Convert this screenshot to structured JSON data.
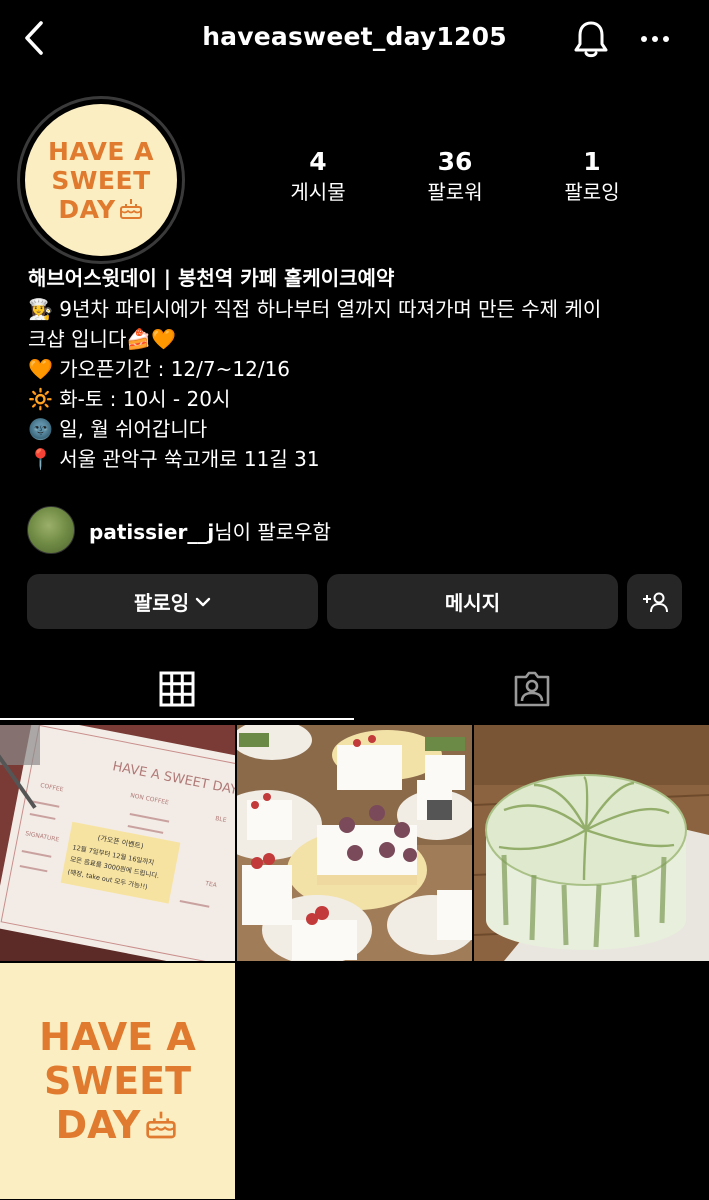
{
  "header": {
    "username": "haveasweet_day1205",
    "back_icon": "chevron-left-icon",
    "bell_icon": "bell-icon",
    "more_icon": "more-horizontal-icon"
  },
  "profile": {
    "avatar_text": [
      "HAVE A",
      "SWEET",
      "DAY"
    ],
    "stats": [
      {
        "value": "4",
        "label": "게시물"
      },
      {
        "value": "36",
        "label": "팔로워"
      },
      {
        "value": "1",
        "label": "팔로잉"
      }
    ],
    "name": "해브어스윗데이 | 봉천역 카페 홀케이크예약",
    "bio_lines": [
      "👩‍🍳 9년차 파티시에가 직접 하나부터 열까지 따져가며 만든 수제 케이",
      "크샵 입니다🍰🧡",
      "🧡 가오픈기간 : 12/7~12/16",
      "🔆 화-토 : 10시 - 20시",
      "🌚 일, 월 쉬어갑니다",
      "📍 서울 관악구 쑥고개로 11길 31"
    ],
    "followed_by_user": "patissier__j",
    "followed_by_suffix": "님이 팔로우함"
  },
  "actions": {
    "following_label": "팔로잉",
    "message_label": "메시지",
    "add_person_icon": "add-person-icon"
  },
  "tabs": {
    "grid_icon": "grid-icon",
    "tagged_icon": "tagged-person-icon"
  },
  "posts": {
    "menu_title": "HAVE A SWEET DAY",
    "menu_sections": [
      "COFFEE",
      "NON COFFEE",
      "SIGNATURE",
      "BLE",
      "TEA"
    ],
    "note_lines": [
      "(가오픈 이벤트)",
      "12월 7일부터 12월 16일까지",
      "모든 음료를 3000원에 드립니다.",
      "(매장, take out 모두 가능!!)"
    ],
    "tile4_text": [
      "HAVE A",
      "SWEET",
      "DAY"
    ]
  },
  "colors": {
    "background": "#000000",
    "button": "#262626",
    "logo_orange": "#e07a2e",
    "logo_cream": "#fbeec2"
  }
}
